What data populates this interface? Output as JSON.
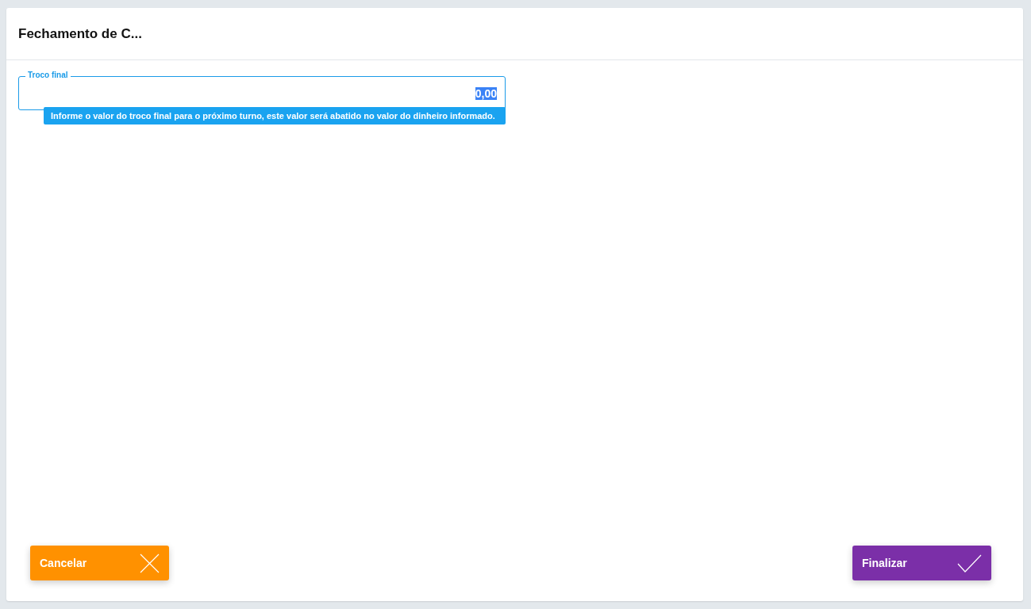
{
  "dialog": {
    "title": "Fechamento de C..."
  },
  "field": {
    "label": "Troco final",
    "value": "0,00",
    "value_selected": true,
    "hint": "Informe o valor do troco final para o próximo turno, este valor será abatido no valor do dinheiro informado."
  },
  "buttons": [
    {
      "label": "Cancelar",
      "kind": "cancel"
    },
    {
      "label": "Finalizar",
      "kind": "confirm"
    }
  ]
}
